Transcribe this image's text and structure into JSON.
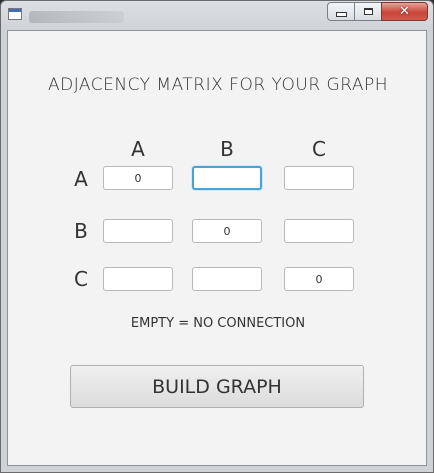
{
  "window": {
    "icons": {
      "app": "app-window-icon",
      "minimize": "minimize-icon",
      "maximize": "maximize-icon",
      "close": "close-icon"
    },
    "close_glyph": "✕",
    "close_color": "#c9463a"
  },
  "matrix": {
    "heading": "ADJACENCY MATRIX FOR YOUR GRAPH",
    "columns": [
      "A",
      "B",
      "C"
    ],
    "rows": [
      "A",
      "B",
      "C"
    ],
    "values": [
      [
        "0",
        "",
        ""
      ],
      [
        "",
        "0",
        ""
      ],
      [
        "",
        "",
        "0"
      ]
    ],
    "focused_cell": "A-B",
    "focus_color": "#4aa3d8"
  },
  "note": "EMPTY = NO CONNECTION",
  "build_button": {
    "label": "BUILD GRAPH"
  }
}
